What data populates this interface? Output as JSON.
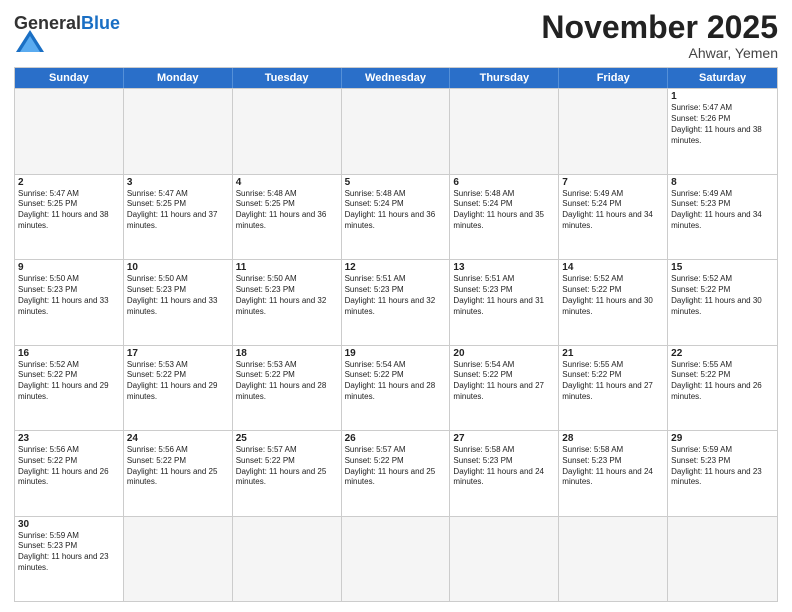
{
  "header": {
    "logo_general": "General",
    "logo_blue": "Blue",
    "month_title": "November 2025",
    "location": "Ahwar, Yemen"
  },
  "days_of_week": [
    "Sunday",
    "Monday",
    "Tuesday",
    "Wednesday",
    "Thursday",
    "Friday",
    "Saturday"
  ],
  "weeks": [
    [
      {
        "day": null,
        "sunrise": null,
        "sunset": null,
        "daylight": null
      },
      {
        "day": null,
        "sunrise": null,
        "sunset": null,
        "daylight": null
      },
      {
        "day": null,
        "sunrise": null,
        "sunset": null,
        "daylight": null
      },
      {
        "day": null,
        "sunrise": null,
        "sunset": null,
        "daylight": null
      },
      {
        "day": null,
        "sunrise": null,
        "sunset": null,
        "daylight": null
      },
      {
        "day": null,
        "sunrise": null,
        "sunset": null,
        "daylight": null
      },
      {
        "day": "1",
        "sunrise": "5:47 AM",
        "sunset": "5:26 PM",
        "daylight": "11 hours and 38 minutes."
      }
    ],
    [
      {
        "day": "2",
        "sunrise": "5:47 AM",
        "sunset": "5:25 PM",
        "daylight": "11 hours and 38 minutes."
      },
      {
        "day": "3",
        "sunrise": "5:47 AM",
        "sunset": "5:25 PM",
        "daylight": "11 hours and 37 minutes."
      },
      {
        "day": "4",
        "sunrise": "5:48 AM",
        "sunset": "5:25 PM",
        "daylight": "11 hours and 36 minutes."
      },
      {
        "day": "5",
        "sunrise": "5:48 AM",
        "sunset": "5:24 PM",
        "daylight": "11 hours and 36 minutes."
      },
      {
        "day": "6",
        "sunrise": "5:48 AM",
        "sunset": "5:24 PM",
        "daylight": "11 hours and 35 minutes."
      },
      {
        "day": "7",
        "sunrise": "5:49 AM",
        "sunset": "5:24 PM",
        "daylight": "11 hours and 34 minutes."
      },
      {
        "day": "8",
        "sunrise": "5:49 AM",
        "sunset": "5:23 PM",
        "daylight": "11 hours and 34 minutes."
      }
    ],
    [
      {
        "day": "9",
        "sunrise": "5:50 AM",
        "sunset": "5:23 PM",
        "daylight": "11 hours and 33 minutes."
      },
      {
        "day": "10",
        "sunrise": "5:50 AM",
        "sunset": "5:23 PM",
        "daylight": "11 hours and 33 minutes."
      },
      {
        "day": "11",
        "sunrise": "5:50 AM",
        "sunset": "5:23 PM",
        "daylight": "11 hours and 32 minutes."
      },
      {
        "day": "12",
        "sunrise": "5:51 AM",
        "sunset": "5:23 PM",
        "daylight": "11 hours and 32 minutes."
      },
      {
        "day": "13",
        "sunrise": "5:51 AM",
        "sunset": "5:23 PM",
        "daylight": "11 hours and 31 minutes."
      },
      {
        "day": "14",
        "sunrise": "5:52 AM",
        "sunset": "5:22 PM",
        "daylight": "11 hours and 30 minutes."
      },
      {
        "day": "15",
        "sunrise": "5:52 AM",
        "sunset": "5:22 PM",
        "daylight": "11 hours and 30 minutes."
      }
    ],
    [
      {
        "day": "16",
        "sunrise": "5:52 AM",
        "sunset": "5:22 PM",
        "daylight": "11 hours and 29 minutes."
      },
      {
        "day": "17",
        "sunrise": "5:53 AM",
        "sunset": "5:22 PM",
        "daylight": "11 hours and 29 minutes."
      },
      {
        "day": "18",
        "sunrise": "5:53 AM",
        "sunset": "5:22 PM",
        "daylight": "11 hours and 28 minutes."
      },
      {
        "day": "19",
        "sunrise": "5:54 AM",
        "sunset": "5:22 PM",
        "daylight": "11 hours and 28 minutes."
      },
      {
        "day": "20",
        "sunrise": "5:54 AM",
        "sunset": "5:22 PM",
        "daylight": "11 hours and 27 minutes."
      },
      {
        "day": "21",
        "sunrise": "5:55 AM",
        "sunset": "5:22 PM",
        "daylight": "11 hours and 27 minutes."
      },
      {
        "day": "22",
        "sunrise": "5:55 AM",
        "sunset": "5:22 PM",
        "daylight": "11 hours and 26 minutes."
      }
    ],
    [
      {
        "day": "23",
        "sunrise": "5:56 AM",
        "sunset": "5:22 PM",
        "daylight": "11 hours and 26 minutes."
      },
      {
        "day": "24",
        "sunrise": "5:56 AM",
        "sunset": "5:22 PM",
        "daylight": "11 hours and 25 minutes."
      },
      {
        "day": "25",
        "sunrise": "5:57 AM",
        "sunset": "5:22 PM",
        "daylight": "11 hours and 25 minutes."
      },
      {
        "day": "26",
        "sunrise": "5:57 AM",
        "sunset": "5:22 PM",
        "daylight": "11 hours and 25 minutes."
      },
      {
        "day": "27",
        "sunrise": "5:58 AM",
        "sunset": "5:23 PM",
        "daylight": "11 hours and 24 minutes."
      },
      {
        "day": "28",
        "sunrise": "5:58 AM",
        "sunset": "5:23 PM",
        "daylight": "11 hours and 24 minutes."
      },
      {
        "day": "29",
        "sunrise": "5:59 AM",
        "sunset": "5:23 PM",
        "daylight": "11 hours and 23 minutes."
      }
    ],
    [
      {
        "day": "30",
        "sunrise": "5:59 AM",
        "sunset": "5:23 PM",
        "daylight": "11 hours and 23 minutes."
      },
      {
        "day": null,
        "sunrise": null,
        "sunset": null,
        "daylight": null
      },
      {
        "day": null,
        "sunrise": null,
        "sunset": null,
        "daylight": null
      },
      {
        "day": null,
        "sunrise": null,
        "sunset": null,
        "daylight": null
      },
      {
        "day": null,
        "sunrise": null,
        "sunset": null,
        "daylight": null
      },
      {
        "day": null,
        "sunrise": null,
        "sunset": null,
        "daylight": null
      },
      {
        "day": null,
        "sunrise": null,
        "sunset": null,
        "daylight": null
      }
    ]
  ],
  "labels": {
    "sunrise": "Sunrise:",
    "sunset": "Sunset:",
    "daylight": "Daylight:"
  }
}
